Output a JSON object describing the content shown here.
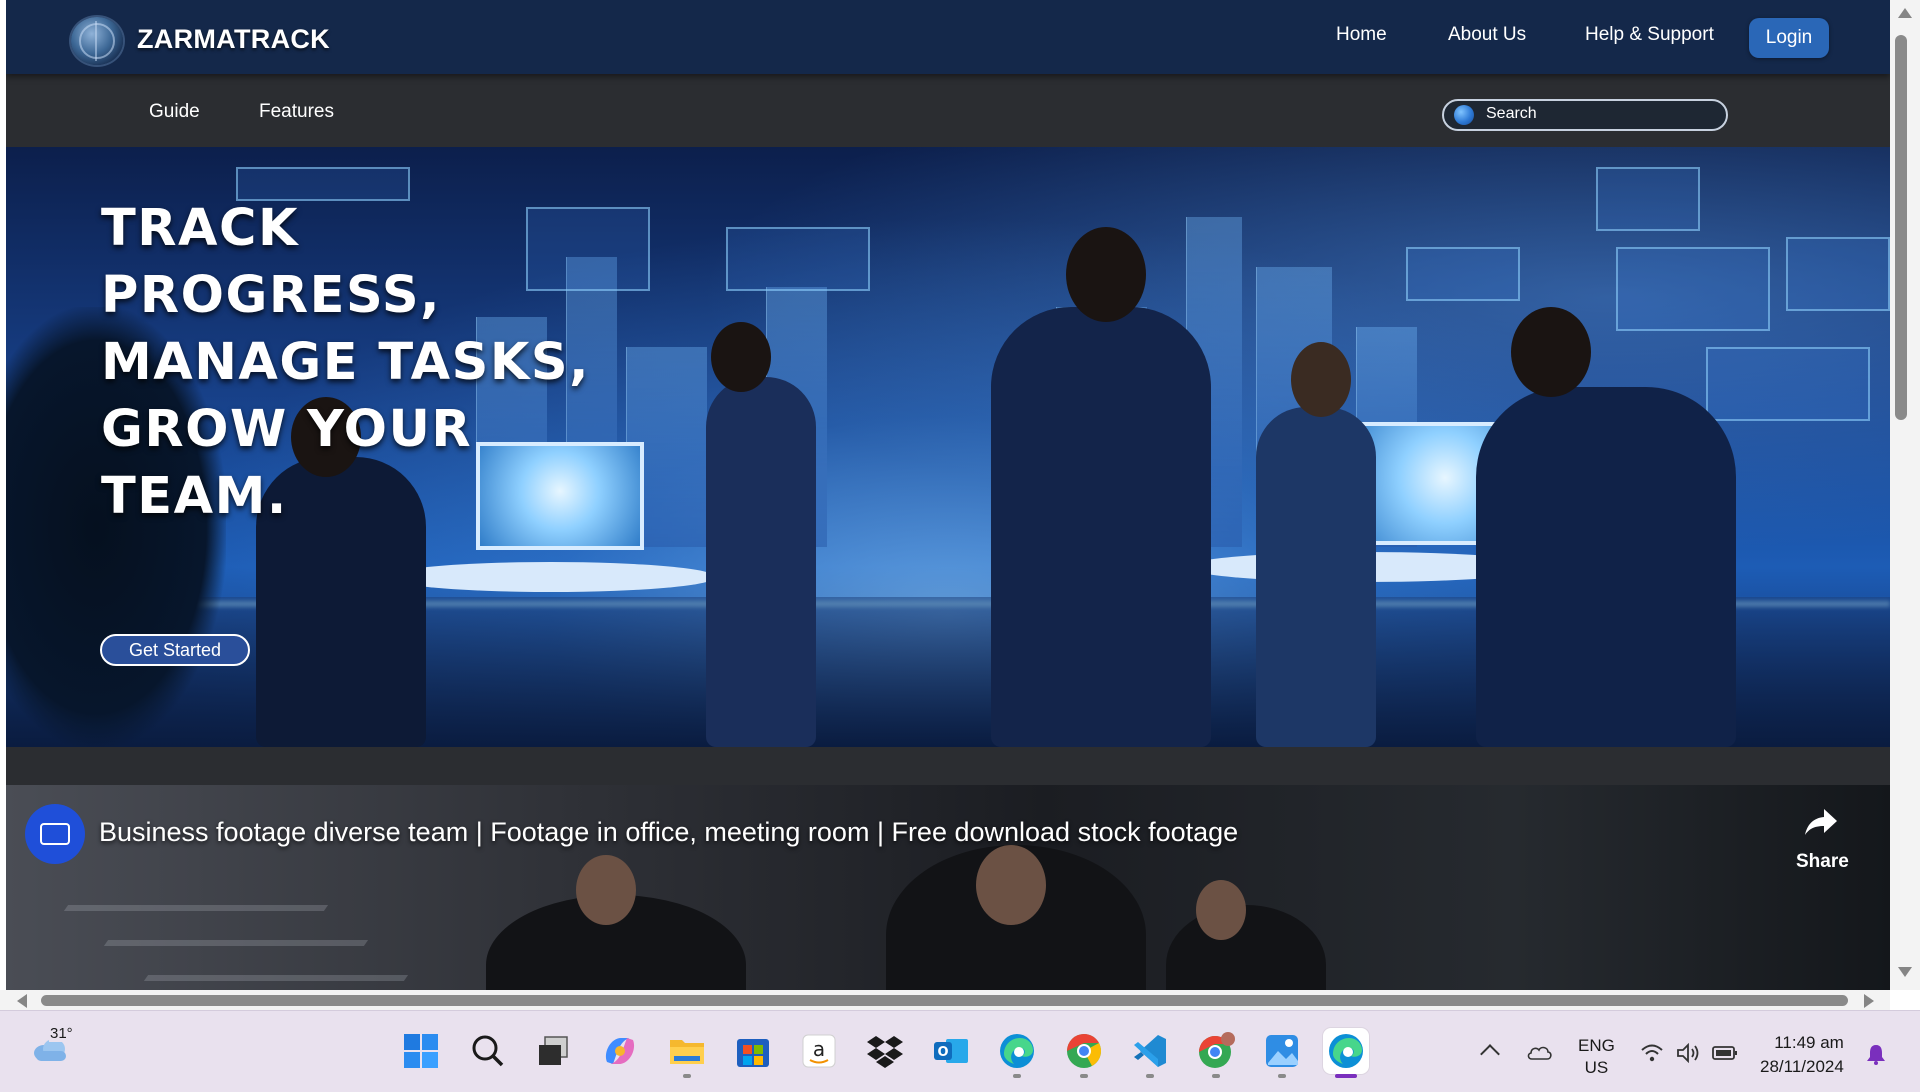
{
  "site": {
    "brand": "ZARMATRACK",
    "nav": {
      "home": "Home",
      "about": "About Us",
      "help": "Help & Support",
      "login": "Login"
    },
    "subnav": {
      "guide": "Guide",
      "features": "Features"
    },
    "search": {
      "placeholder": "Search"
    }
  },
  "hero": {
    "title": "TRACK PROGRESS, MANAGE TASKS, GROW YOUR TEAM.",
    "cta": "Get Started"
  },
  "video": {
    "title": "Business footage diverse team | Footage in office, meeting room | Free download stock footage",
    "channel_logo_icon": "footage-channel-logo-icon",
    "share_label": "Share"
  },
  "taskbar": {
    "weather_temp": "31°",
    "apps": [
      {
        "name": "windows-start-icon"
      },
      {
        "name": "search-icon"
      },
      {
        "name": "task-view-icon"
      },
      {
        "name": "copilot-icon"
      },
      {
        "name": "file-explorer-icon"
      },
      {
        "name": "microsoft-store-icon"
      },
      {
        "name": "amazon-icon"
      },
      {
        "name": "dropbox-icon"
      },
      {
        "name": "outlook-icon"
      },
      {
        "name": "edge-icon"
      },
      {
        "name": "chrome-icon"
      },
      {
        "name": "vscode-icon"
      },
      {
        "name": "chrome-profile-icon"
      },
      {
        "name": "photos-icon"
      },
      {
        "name": "edge-active-icon"
      }
    ],
    "language_line1": "ENG",
    "language_line2": "US",
    "time": "11:49 am",
    "date": "28/11/2024"
  },
  "colors": {
    "topbar": "#14284a",
    "subnav": "#2b2d31",
    "login_button": "#2a67b7",
    "cta_button": "#2a4f9a",
    "taskbar": "#e9e1ee",
    "active_indicator": "#7a2fbd"
  }
}
